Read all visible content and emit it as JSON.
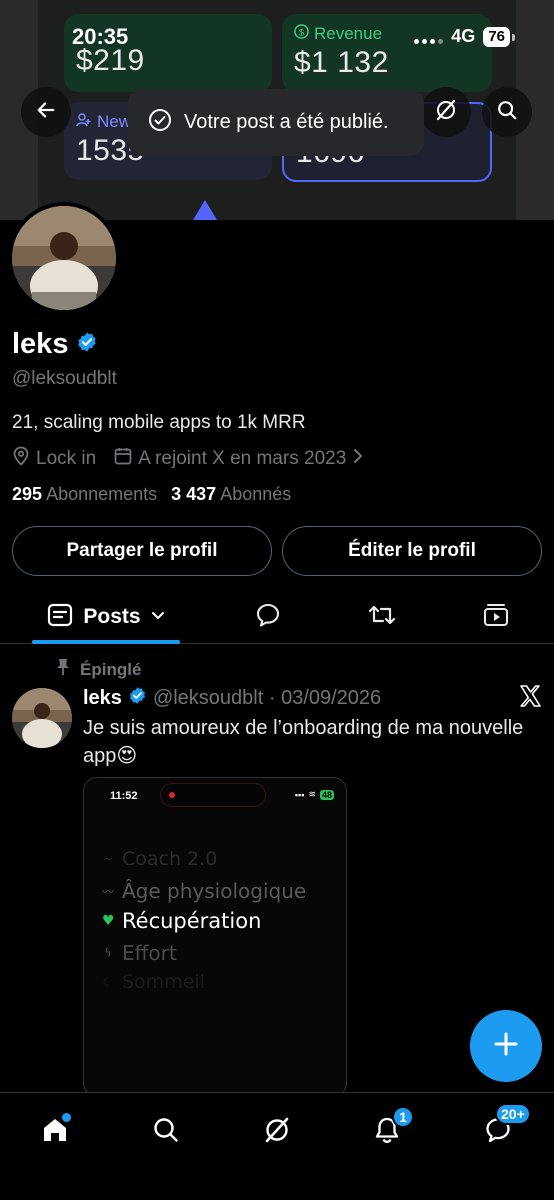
{
  "status_bar": {
    "time": "20:35",
    "network": "4G",
    "battery": "76"
  },
  "banner": {
    "cards": [
      {
        "label": "",
        "value": "$219",
        "icon": "dollar-circle-icon"
      },
      {
        "label": "Revenue",
        "value": "$1 132",
        "icon": "dollar-circle-icon"
      },
      {
        "label": "New",
        "value": "1535",
        "icon": "users-icon"
      },
      {
        "label": "",
        "value": "1696",
        "icon": ""
      }
    ]
  },
  "toast": {
    "text": "Votre post a été publié.",
    "icon": "check-circle-icon"
  },
  "profile": {
    "name": "leks",
    "handle": "@leksoudblt",
    "bio": "21, scaling mobile apps to 1k MRR",
    "location": "Lock in",
    "joined": "A rejoint X en mars 2023",
    "following_count": "295",
    "following_label": "Abonnements",
    "followers_count": "3 437",
    "followers_label": "Abonnés"
  },
  "actions": {
    "share": "Partager le profil",
    "edit": "Éditer le profil"
  },
  "tabs": {
    "posts": "Posts"
  },
  "post": {
    "pinned_label": "Épinglé",
    "author": "leks",
    "meta": "@leksoudblt · 03/09/2026",
    "text": "Je suis amoureux de l’onboarding de ma nouvelle app😍",
    "media": {
      "time": "11:52",
      "battery": "48",
      "items": [
        "Coach 2.0",
        "Âge physiologique",
        "Récupération",
        "Effort",
        "Sommeil"
      ]
    }
  },
  "bottom_nav": {
    "notifications_badge": "1",
    "messages_badge": "20+"
  },
  "colors": {
    "accent": "#1d9bf0",
    "muted": "#71767b",
    "green": "#3ccf7e",
    "purple": "#5566ff"
  }
}
